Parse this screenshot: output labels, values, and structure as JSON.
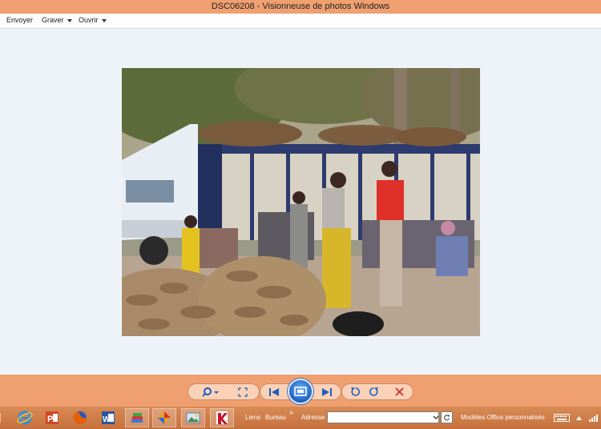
{
  "window": {
    "title": "DSC06208 - Visionneuse de photos Windows"
  },
  "menu": {
    "items": [
      {
        "label": "Envoyer",
        "has_dropdown": false
      },
      {
        "label": "Graver",
        "has_dropdown": true
      },
      {
        "label": "Ouvrir",
        "has_dropdown": true
      }
    ]
  },
  "controls": {
    "buttons": [
      "zoom-icon",
      "fit-to-window-icon",
      "previous-icon",
      "slideshow-icon",
      "next-icon",
      "rotate-counterclockwise-icon",
      "rotate-clockwise-icon",
      "delete-icon"
    ]
  },
  "taskbar": {
    "apps": [
      "internet-explorer-icon",
      "powerpoint-icon",
      "firefox-icon",
      "word-icon",
      "books-icon",
      "app-icon",
      "photo-viewer-icon",
      "kaspersky-icon"
    ],
    "links_label": "Liens",
    "desktop_label": "Bureau",
    "chevron": "»",
    "address_label": "Adresse",
    "address_value": "",
    "templates_label": "Modèles Office personnalisés"
  },
  "colors": {
    "title_bar": "#f0a070",
    "viewer_background": "#eef3fa",
    "control_accent": "#1d5fc1",
    "taskbar": "#c6713d"
  }
}
